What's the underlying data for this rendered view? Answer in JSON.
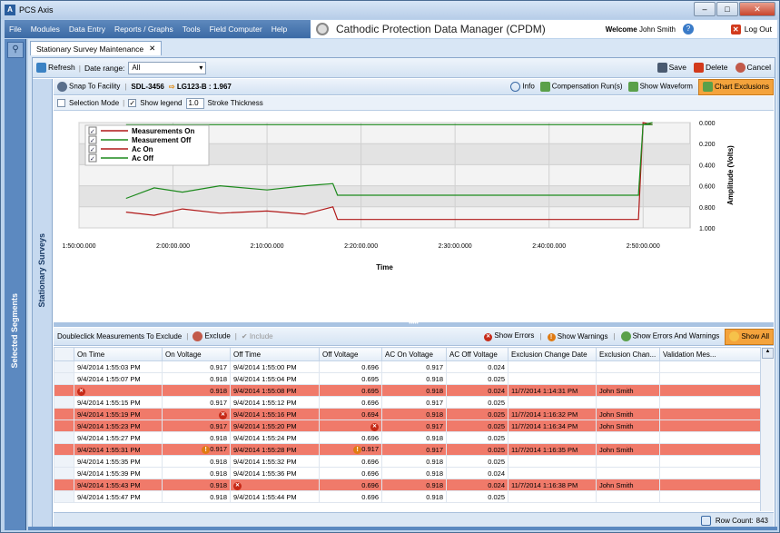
{
  "window": {
    "title": "PCS Axis",
    "controls": [
      "–",
      "□",
      "✕"
    ]
  },
  "menu": {
    "items": [
      "File",
      "Modules",
      "Data Entry",
      "Reports / Graphs",
      "Tools",
      "Field Computer",
      "Help"
    ],
    "app_title": "Cathodic Protection Data Manager (CPDM)",
    "welcome_label": "Welcome",
    "user": "John Smith",
    "logout": "Log Out"
  },
  "leftrail": {
    "label": "Selected Segments"
  },
  "tab": {
    "label": "Stationary Survey Maintenance",
    "close": "✕"
  },
  "toolbar": {
    "refresh": "Refresh",
    "date_range_label": "Date range:",
    "date_range_value": "All",
    "save": "Save",
    "delete": "Delete",
    "cancel": "Cancel"
  },
  "sidestrip": {
    "label": "Stationary Surveys"
  },
  "facility_bar": {
    "snap": "Snap To Facility",
    "sdl": "SDL-3456",
    "lg": "LG123-B : 1.967",
    "info": "Info",
    "compensation": "Compensation Run(s)",
    "waveform": "Show Waveform",
    "exclusions": "Chart Exclusions"
  },
  "options_bar": {
    "selection_mode": "Selection Mode",
    "show_legend": "Show legend",
    "stroke_value": "1.0",
    "stroke_label": "Stroke Thickness"
  },
  "chart_data": {
    "type": "line",
    "xlabel": "Time",
    "ylabel": "Amplitude (Volts)",
    "x_ticks": [
      "1:50:00.000",
      "2:00:00.000",
      "2:10:00.000",
      "2:20:00.000",
      "2:30:00.000",
      "2:40:00.000",
      "2:50:00.000"
    ],
    "y_ticks": [
      "0.000",
      "0.200",
      "0.400",
      "0.600",
      "0.800",
      "1.000"
    ],
    "ylim": [
      0,
      1
    ],
    "y_inverted": true,
    "grid": true,
    "legend_position": "top-left",
    "series": [
      {
        "name": "Measurements On",
        "color": "#b01818",
        "x": [
          "1:55:00",
          "1:58:00",
          "2:01:00",
          "2:05:00",
          "2:10:00",
          "2:14:00",
          "2:17:00",
          "2:17:30",
          "2:25:00",
          "2:35:00",
          "2:45:00",
          "2:49:30",
          "2:50:00",
          "2:51:00"
        ],
        "values": [
          0.85,
          0.88,
          0.82,
          0.86,
          0.84,
          0.87,
          0.8,
          0.92,
          0.92,
          0.92,
          0.92,
          0.92,
          0.0,
          0.02
        ]
      },
      {
        "name": "Measurement Off",
        "color": "#1d8a1d",
        "x": [
          "1:55:00",
          "2:17:00",
          "2:20:00",
          "2:35:00",
          "2:49:00",
          "2:49:30",
          "2:50:00",
          "2:51:00"
        ],
        "values": [
          0.02,
          0.02,
          0.02,
          0.02,
          0.02,
          0.02,
          0.02,
          0.02
        ]
      },
      {
        "name": "Ac On",
        "color": "#b01818",
        "x": [],
        "values": []
      },
      {
        "name": "Ac Off",
        "color": "#1d8a1d",
        "x": [
          "1:55:00",
          "1:58:00",
          "2:01:00",
          "2:05:00",
          "2:10:00",
          "2:14:00",
          "2:17:00",
          "2:17:30",
          "2:25:00",
          "2:35:00",
          "2:45:00",
          "2:49:30",
          "2:50:00",
          "2:51:00"
        ],
        "values": [
          0.72,
          0.62,
          0.66,
          0.6,
          0.64,
          0.6,
          0.58,
          0.69,
          0.69,
          0.69,
          0.69,
          0.69,
          0.02,
          0.0
        ]
      }
    ]
  },
  "grid_toolbar": {
    "doubleclick": "Doubleclick Measurements To Exclude",
    "exclude": "Exclude",
    "include": "Include",
    "show_errors": "Show Errors",
    "show_warnings": "Show Warnings",
    "show_errors_warnings": "Show Errors And Warnings",
    "show_all": "Show All"
  },
  "table": {
    "headers": [
      "On Time",
      "On Voltage",
      "Off Time",
      "Off Voltage",
      "AC On Voltage",
      "AC Off Voltage",
      "Exclusion Change Date",
      "Exclusion Chan...",
      "Validation Mes..."
    ],
    "rows": [
      {
        "on_time": "9/4/2014 1:55:03 PM",
        "on_v": "0.917",
        "off_time": "9/4/2014 1:55:00 PM",
        "off_v": "0.696",
        "ac_on": "0.917",
        "ac_off": "0.024",
        "exc_date": "",
        "exc_by": "",
        "val": "",
        "state": "",
        "on_icon": "",
        "off_icon": "",
        "offv_icon": ""
      },
      {
        "on_time": "9/4/2014 1:55:07 PM",
        "on_v": "0.918",
        "off_time": "9/4/2014 1:55:04 PM",
        "off_v": "0.695",
        "ac_on": "0.918",
        "ac_off": "0.025",
        "exc_date": "",
        "exc_by": "",
        "val": "",
        "state": "",
        "on_icon": "",
        "off_icon": "",
        "offv_icon": ""
      },
      {
        "on_time": "",
        "on_v": "0.918",
        "off_time": "9/4/2014 1:55:08 PM",
        "off_v": "0.695",
        "ac_on": "0.918",
        "ac_off": "0.024",
        "exc_date": "11/7/2014 1:14:31 PM",
        "exc_by": "John Smith",
        "val": "",
        "state": "err",
        "on_icon": "err",
        "off_icon": "",
        "offv_icon": ""
      },
      {
        "on_time": "9/4/2014 1:55:15 PM",
        "on_v": "0.917",
        "off_time": "9/4/2014 1:55:12 PM",
        "off_v": "0.696",
        "ac_on": "0.917",
        "ac_off": "0.025",
        "exc_date": "",
        "exc_by": "",
        "val": "",
        "state": "",
        "on_icon": "",
        "off_icon": "",
        "offv_icon": ""
      },
      {
        "on_time": "9/4/2014 1:55:19 PM",
        "on_v": "",
        "off_time": "9/4/2014 1:55:16 PM",
        "off_v": "0.694",
        "ac_on": "0.918",
        "ac_off": "0.025",
        "exc_date": "11/7/2014 1:16:32 PM",
        "exc_by": "John Smith",
        "val": "",
        "state": "err",
        "on_icon": "",
        "onv_icon": "err",
        "off_icon": "",
        "offv_icon": ""
      },
      {
        "on_time": "9/4/2014 1:55:23 PM",
        "on_v": "0.917",
        "off_time": "9/4/2014 1:55:20 PM",
        "off_v": "",
        "ac_on": "0.917",
        "ac_off": "0.025",
        "exc_date": "11/7/2014 1:16:34 PM",
        "exc_by": "John Smith",
        "val": "",
        "state": "err",
        "on_icon": "",
        "off_icon": "",
        "offv_icon": "err"
      },
      {
        "on_time": "9/4/2014 1:55:27 PM",
        "on_v": "0.918",
        "off_time": "9/4/2014 1:55:24 PM",
        "off_v": "0.696",
        "ac_on": "0.918",
        "ac_off": "0.025",
        "exc_date": "",
        "exc_by": "",
        "val": "",
        "state": "",
        "on_icon": "",
        "off_icon": "",
        "offv_icon": ""
      },
      {
        "on_time": "9/4/2014 1:55:31 PM",
        "on_v": "0.917",
        "off_time": "9/4/2014 1:55:28 PM",
        "off_v": "0.917",
        "ac_on": "0.917",
        "ac_off": "0.025",
        "exc_date": "11/7/2014 1:16:35 PM",
        "exc_by": "John Smith",
        "val": "",
        "state": "err",
        "on_icon": "",
        "onv_icon": "warn",
        "off_icon": "",
        "offv_icon": "warn"
      },
      {
        "on_time": "9/4/2014 1:55:35 PM",
        "on_v": "0.918",
        "off_time": "9/4/2014 1:55:32 PM",
        "off_v": "0.696",
        "ac_on": "0.918",
        "ac_off": "0.025",
        "exc_date": "",
        "exc_by": "",
        "val": "",
        "state": "",
        "on_icon": "",
        "off_icon": "",
        "offv_icon": ""
      },
      {
        "on_time": "9/4/2014 1:55:39 PM",
        "on_v": "0.918",
        "off_time": "9/4/2014 1:55:36 PM",
        "off_v": "0.696",
        "ac_on": "0.918",
        "ac_off": "0.024",
        "exc_date": "",
        "exc_by": "",
        "val": "",
        "state": "",
        "on_icon": "",
        "off_icon": "",
        "offv_icon": ""
      },
      {
        "on_time": "9/4/2014 1:55:43 PM",
        "on_v": "0.918",
        "off_time": "",
        "off_v": "0.696",
        "ac_on": "0.918",
        "ac_off": "0.024",
        "exc_date": "11/7/2014 1:16:38 PM",
        "exc_by": "John Smith",
        "val": "",
        "state": "err",
        "on_icon": "",
        "off_icon": "err",
        "offv_icon": ""
      },
      {
        "on_time": "9/4/2014 1:55:47 PM",
        "on_v": "0.918",
        "off_time": "9/4/2014 1:55:44 PM",
        "off_v": "0.696",
        "ac_on": "0.918",
        "ac_off": "0.025",
        "exc_date": "",
        "exc_by": "",
        "val": "",
        "state": "",
        "on_icon": "",
        "off_icon": "",
        "offv_icon": ""
      }
    ]
  },
  "footer": {
    "row_count_label": "Row Count:",
    "row_count": "843"
  }
}
